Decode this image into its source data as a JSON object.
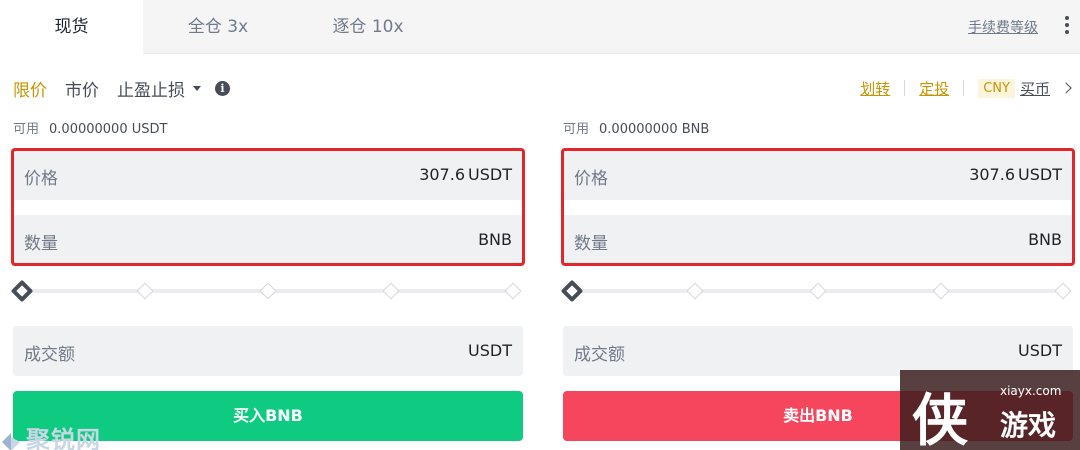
{
  "tabs": [
    {
      "label": "现货"
    },
    {
      "label": "全仓 3x"
    },
    {
      "label": "逐仓 10x"
    }
  ],
  "fee_link": "手续费等级",
  "order_types": {
    "limit": "限价",
    "market": "市价",
    "stop": "止盈止损"
  },
  "right_links": {
    "transfer": "划转",
    "auto_invest": "定投",
    "currency": "CNY",
    "buy_coin": "买币"
  },
  "buy": {
    "available_label": "可用",
    "available_value": "0.00000000 USDT",
    "price_label": "价格",
    "price_value": "307.6",
    "price_unit": "USDT",
    "qty_label": "数量",
    "qty_unit": "BNB",
    "total_label": "成交额",
    "total_unit": "USDT",
    "button": "买入BNB"
  },
  "sell": {
    "available_label": "可用",
    "available_value": "0.00000000 BNB",
    "price_label": "价格",
    "price_value": "307.6",
    "price_unit": "USDT",
    "qty_label": "数量",
    "qty_unit": "BNB",
    "total_label": "成交额",
    "total_unit": "USDT",
    "button": "卖出BNB"
  },
  "slider_percent": 0,
  "watermarks": {
    "left": "聚锐网",
    "right_big": "侠",
    "right_url": "xiayx.com",
    "right_cn": "游戏"
  },
  "colors": {
    "accent": "#c99400",
    "buy": "#0ecb81",
    "sell": "#f6465d",
    "highlight": "#e3262b"
  }
}
